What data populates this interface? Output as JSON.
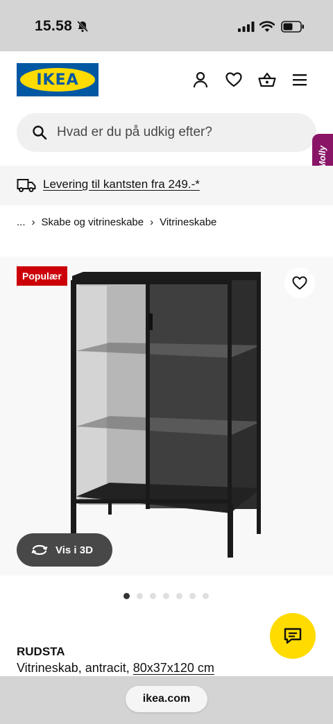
{
  "status_bar": {
    "time": "15.58"
  },
  "header": {
    "logo_text": "IKEA",
    "colors": {
      "brand_blue": "#0058a3",
      "brand_yellow": "#ffdb00"
    },
    "icons": [
      "person-icon",
      "heart-icon",
      "basket-icon",
      "menu-icon"
    ]
  },
  "search": {
    "placeholder": "Hvad er du på udkig efter?"
  },
  "assistant_tab": {
    "label": "Molly"
  },
  "delivery": {
    "text": "Levering til kantsten fra 249.-*"
  },
  "breadcrumb": {
    "items": [
      "...",
      "Skabe og vitrineskabe",
      "Vitrineskabe"
    ]
  },
  "product": {
    "badge": "Populær",
    "badge_color": "#cc0008",
    "view_3d_label": "Vis i 3D",
    "image_count": 7,
    "active_image": 1,
    "name": "RUDSTA",
    "description": "Vitrineskab, antracit,",
    "size": "80x37x120 cm"
  },
  "browser": {
    "url": "ikea.com"
  }
}
